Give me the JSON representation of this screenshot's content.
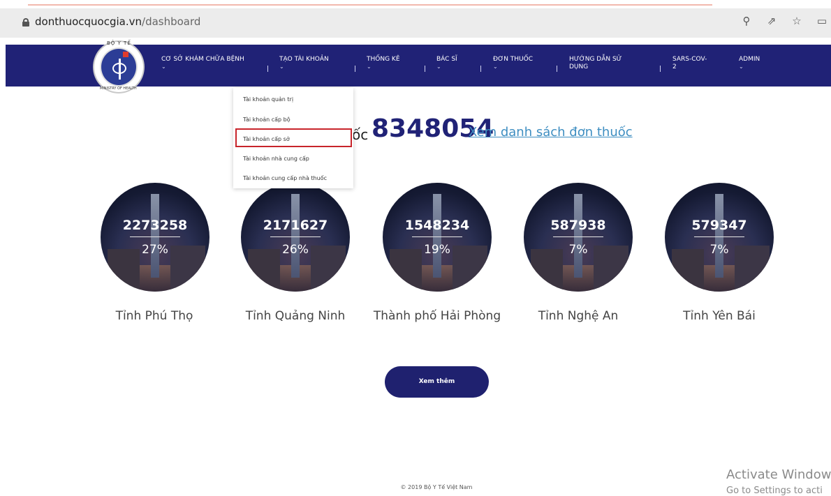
{
  "browser": {
    "domain": "donthuocquocgia.vn",
    "path": "/dashboard",
    "icons": [
      "zoom-icon",
      "share-icon",
      "star-icon",
      "extension-icon"
    ]
  },
  "logo": {
    "top_text": "BỘ Y TẾ",
    "bottom_text": "MINISTRY OF HEALTH"
  },
  "nav": {
    "items": [
      {
        "label": "CƠ SỞ KHÁM CHỮA BỆNH",
        "chevron": "⌄"
      },
      {
        "label": "TẠO TÀI KHOẢN",
        "chevron": "⌄"
      },
      {
        "label": "THỐNG KÊ",
        "chevron": "⌄"
      },
      {
        "label": "BÁC SĨ",
        "chevron": "⌄"
      },
      {
        "label": "ĐƠN THUỐC",
        "chevron": "⌄"
      },
      {
        "label_line1": "HƯỚNG DẪN SỬ",
        "label_line2": "DỤNG"
      },
      {
        "label_line1": "SARS-COV-",
        "label_line2": "2"
      },
      {
        "label": "ADMIN",
        "chevron": "⌄"
      }
    ],
    "separator": "|"
  },
  "dropdown": {
    "items": [
      "Tài khoản quản trị",
      "Tài khoản cấp bộ",
      "Tài khoản cấp sở",
      "Tài khoản nhà cung cấp",
      "Tài khoản cung cấp nhà thuốc"
    ],
    "highlighted_index": 2,
    "highlight_color": "#c8242b"
  },
  "prescriptions": {
    "prefix": "ốc",
    "count": "8348054",
    "link": "Xem danh sách đơn thuốc"
  },
  "stats": [
    {
      "value": "2273258",
      "percent": "27%",
      "label": "Tỉnh Phú Thọ"
    },
    {
      "value": "2171627",
      "percent": "26%",
      "label": "Tỉnh Quảng Ninh"
    },
    {
      "value": "1548234",
      "percent": "19%",
      "label": "Thành phố Hải Phòng"
    },
    {
      "value": "587938",
      "percent": "7%",
      "label": "Tỉnh Nghệ An"
    },
    {
      "value": "579347",
      "percent": "7%",
      "label": "Tỉnh Yên Bái"
    }
  ],
  "more_button": "Xem thêm",
  "footer": "© 2019 Bộ Y Tế Việt Nam",
  "windows_watermark": {
    "line1": "Activate Window",
    "line2": "Go to Settings to acti"
  },
  "colors": {
    "nav_bg": "#202276",
    "count_color": "#202276",
    "link_color": "#3e8ec1",
    "button_bg": "#1f216f"
  }
}
